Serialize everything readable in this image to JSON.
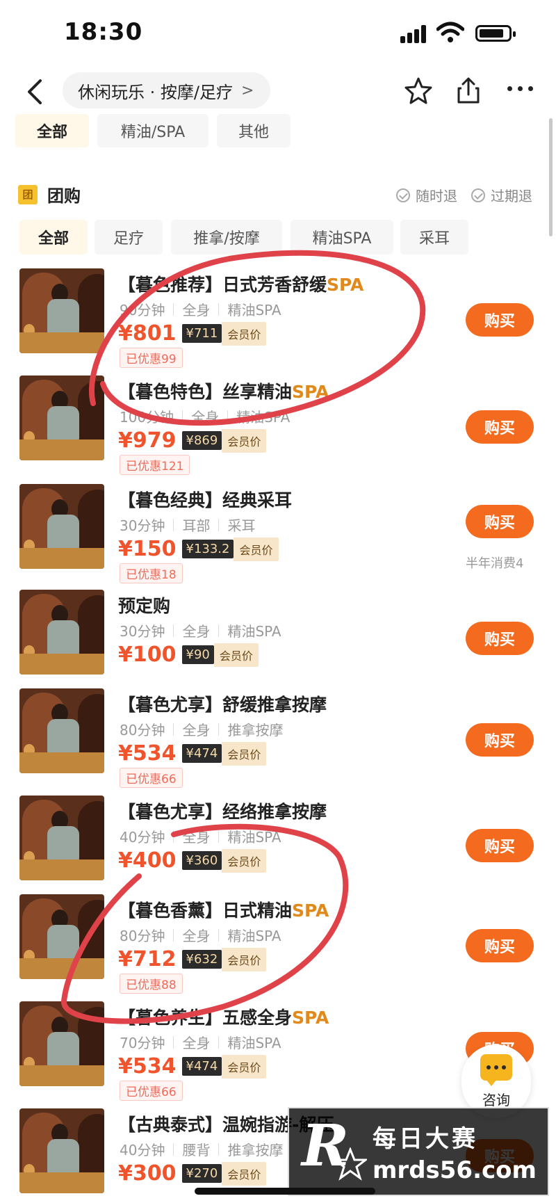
{
  "status_bar": {
    "time": "18:30"
  },
  "nav": {
    "breadcrumb": "休闲玩乐 · 按摩/足疗",
    "breadcrumb_chevron": ">"
  },
  "top_tabs": [
    "全部",
    "精油/SPA",
    "其他"
  ],
  "section": {
    "icon_text": "团",
    "title": "团购",
    "guarantees": [
      "随时退",
      "过期退"
    ]
  },
  "filter_tabs": [
    "全部",
    "足疗",
    "推拿/按摩",
    "精油SPA",
    "采耳"
  ],
  "deals": [
    {
      "title_main": "【暮色推荐】日式芳香舒缓",
      "title_hl": "SPA",
      "meta": [
        "90分钟",
        "全身",
        "精油SPA"
      ],
      "price": "¥801",
      "member_price": "¥711",
      "member_label": "会员价",
      "saved": "已优惠99",
      "buy": "购买",
      "note": ""
    },
    {
      "title_main": "【暮色特色】丝享精油",
      "title_hl": "SPA",
      "meta": [
        "100分钟",
        "全身",
        "精油SPA"
      ],
      "price": "¥979",
      "member_price": "¥869",
      "member_label": "会员价",
      "saved": "已优惠121",
      "buy": "购买",
      "note": ""
    },
    {
      "title_main": "【暮色经典】经典采耳",
      "title_hl": "",
      "meta": [
        "30分钟",
        "耳部",
        "采耳"
      ],
      "price": "¥150",
      "member_price": "¥133.2",
      "member_label": "会员价",
      "saved": "已优惠18",
      "buy": "购买",
      "note": "半年消费4"
    },
    {
      "title_main": "预定购",
      "title_hl": "",
      "meta": [
        "30分钟",
        "全身",
        "精油SPA"
      ],
      "price": "¥100",
      "member_price": "¥90",
      "member_label": "会员价",
      "saved": "",
      "buy": "购买",
      "note": ""
    },
    {
      "title_main": "【暮色尤享】舒缓推拿按摩",
      "title_hl": "",
      "meta": [
        "80分钟",
        "全身",
        "推拿按摩"
      ],
      "price": "¥534",
      "member_price": "¥474",
      "member_label": "会员价",
      "saved": "已优惠66",
      "buy": "购买",
      "note": ""
    },
    {
      "title_main": "【暮色尤享】经络推拿按摩",
      "title_hl": "",
      "meta": [
        "40分钟",
        "全身",
        "精油SPA"
      ],
      "price": "¥400",
      "member_price": "¥360",
      "member_label": "会员价",
      "saved": "",
      "buy": "购买",
      "note": ""
    },
    {
      "title_main": "【暮色香薰】日式精油",
      "title_hl": "SPA",
      "meta": [
        "80分钟",
        "全身",
        "精油SPA"
      ],
      "price": "¥712",
      "member_price": "¥632",
      "member_label": "会员价",
      "saved": "已优惠88",
      "buy": "购买",
      "note": ""
    },
    {
      "title_main": "【暮色养生】五感全身",
      "title_hl": "SPA",
      "meta": [
        "70分钟",
        "全身",
        "精油SPA"
      ],
      "price": "¥534",
      "member_price": "¥474",
      "member_label": "会员价",
      "saved": "已优惠66",
      "buy": "购买",
      "note": ""
    },
    {
      "title_main": "【古典泰式】温婉指游-解压",
      "title_hl": "",
      "meta": [
        "40分钟",
        "腰背",
        "推拿按摩"
      ],
      "price": "¥300",
      "member_price": "¥270",
      "member_label": "会员价",
      "saved": "",
      "buy": "购买",
      "note": ""
    }
  ],
  "consult": {
    "label": "咨询"
  },
  "watermark": {
    "cn": "每日大赛",
    "url": "mrds56.com",
    "logo_letter": "R"
  },
  "colors": {
    "price": "#f0542c",
    "buy_button": "#f46b1f",
    "spa_highlight": "#e08a1e",
    "annotation": "#e0424a"
  }
}
